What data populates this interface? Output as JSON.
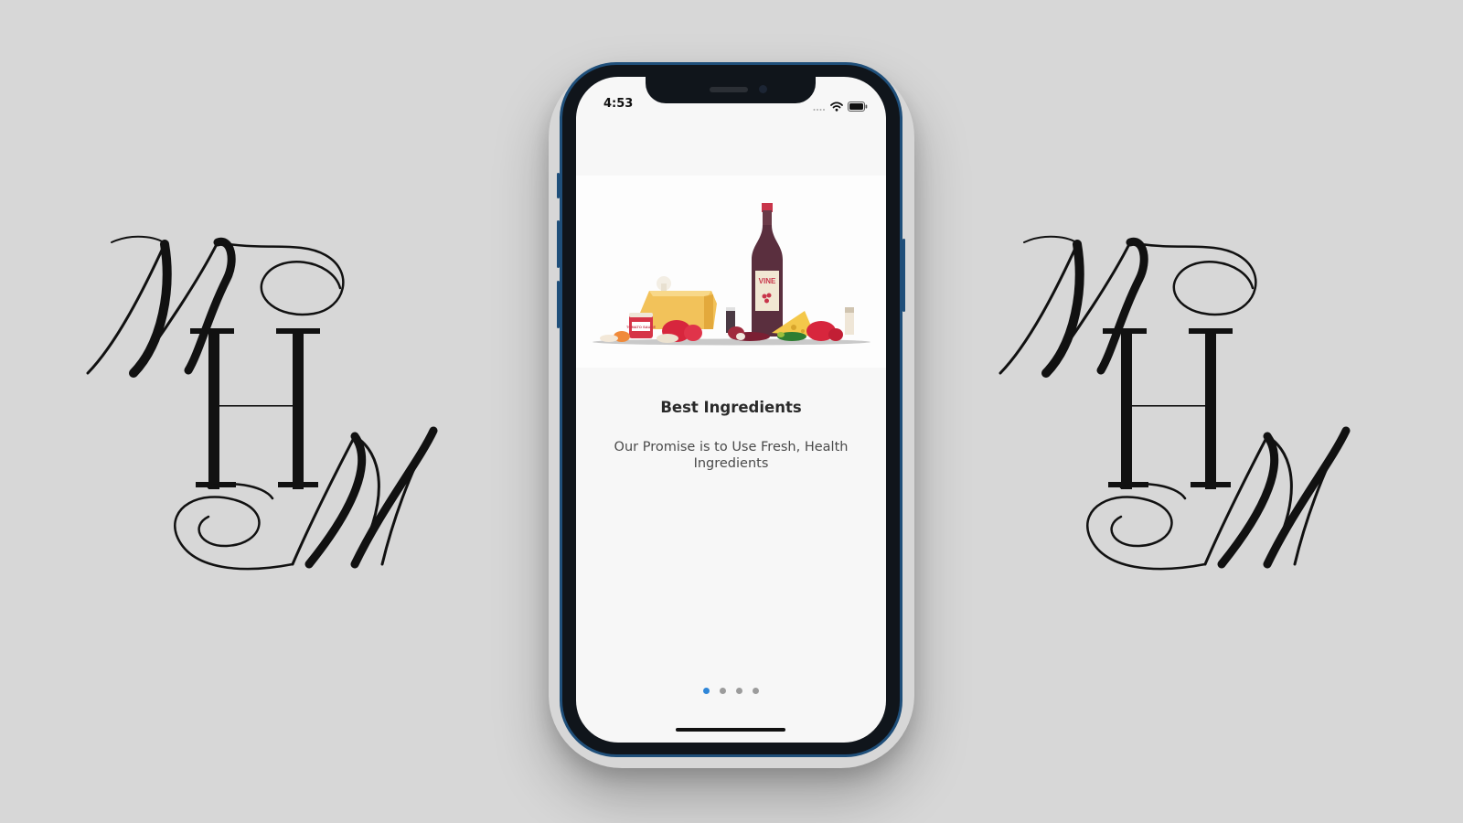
{
  "status_bar": {
    "time": "4:53"
  },
  "onboarding": {
    "title": "Best Ingredients",
    "subtitle": "Our Promise is to Use Fresh, Health Ingredients",
    "page_count": 4,
    "active_page": 1,
    "illustration": {
      "bottle_label": "VINE",
      "jar_label": "TOMATO SAUCE"
    }
  },
  "icons": {
    "signal": "signal-dots-icon",
    "wifi": "wifi-icon",
    "battery": "battery-icon"
  },
  "colors": {
    "background": "#d7d7d7",
    "frame": "#1f4f7a",
    "dot_active": "#2f86d8",
    "dot_inactive": "#9c9c9c"
  }
}
